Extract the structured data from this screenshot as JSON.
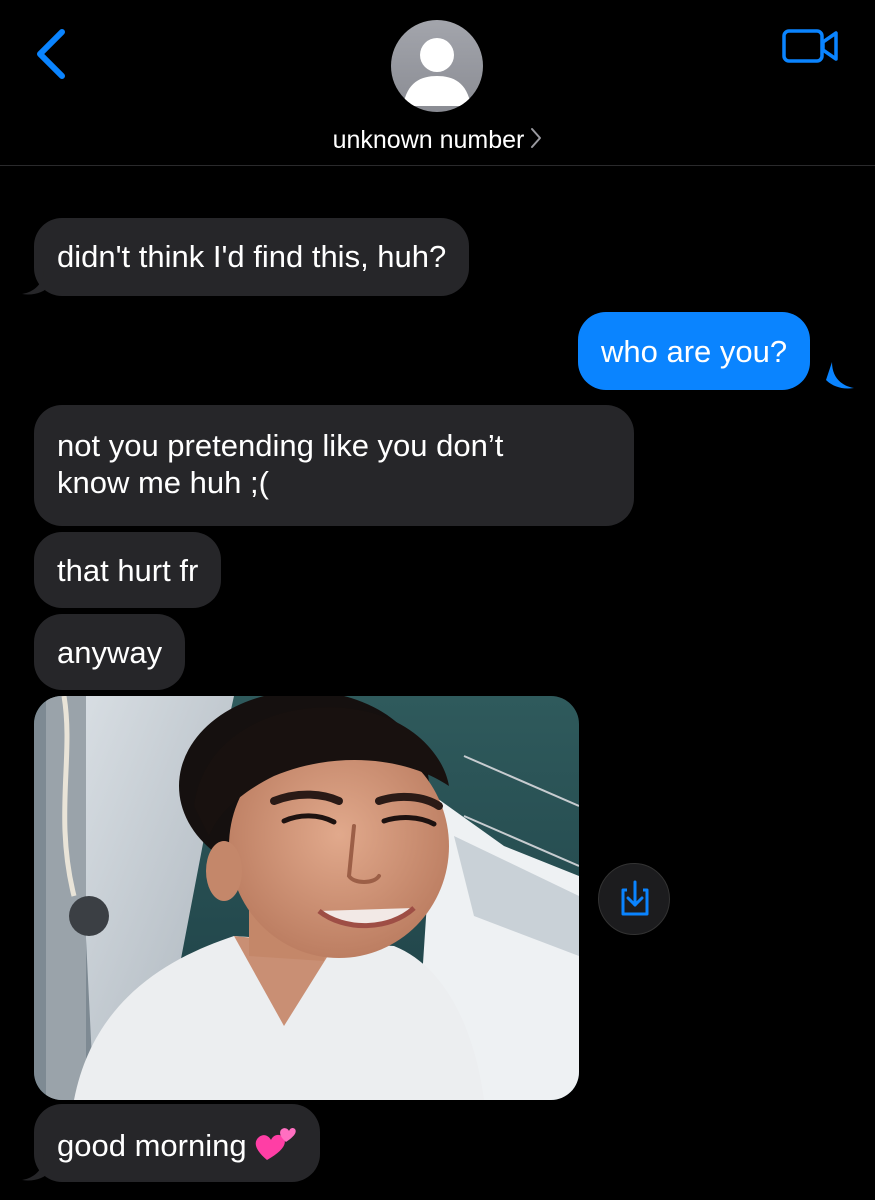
{
  "header": {
    "contact_name": "unknown number",
    "back_icon": "chevron-left-icon",
    "video_icon": "video-camera-icon",
    "avatar_icon": "person-placeholder-icon"
  },
  "messages": [
    {
      "direction": "incoming",
      "text": "didn't think I'd find this, huh?"
    },
    {
      "direction": "outgoing",
      "text": "who are you?"
    },
    {
      "direction": "incoming",
      "lines": [
        "not you pretending like you don’t",
        "know me huh ;("
      ]
    },
    {
      "direction": "incoming",
      "text": "that hurt fr"
    },
    {
      "direction": "incoming",
      "text": "anyway"
    },
    {
      "direction": "incoming",
      "type": "photo",
      "description_icon": "photo-attachment"
    },
    {
      "direction": "incoming",
      "text": "good morning",
      "emoji": "two-hearts-icon"
    }
  ],
  "photo_actions": {
    "save_icon": "save-to-photos-icon"
  },
  "colors": {
    "accent": "#0a84ff",
    "incoming_bubble": "#262629",
    "background": "#000000"
  }
}
